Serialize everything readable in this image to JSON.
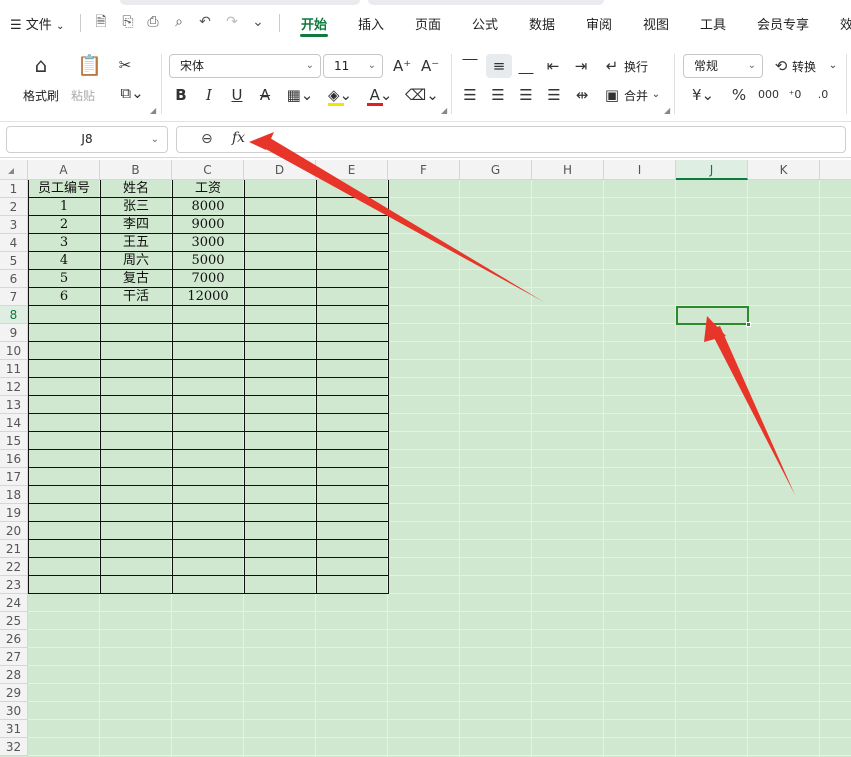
{
  "menu": {
    "file_label": "文件",
    "items": [
      "开始",
      "插入",
      "页面",
      "公式",
      "数据",
      "审阅",
      "视图",
      "工具",
      "会员专享",
      "效"
    ]
  },
  "ribbon": {
    "format_painter": "格式刷",
    "paste": "粘贴",
    "font_name": "宋体",
    "font_size": "11",
    "wrap": "换行",
    "merge": "合并",
    "number_format": "常规",
    "convert": "转换"
  },
  "formula_bar": {
    "name_box": "J8",
    "fx": "fx",
    "formula": ""
  },
  "sheet": {
    "columns": [
      "A",
      "B",
      "C",
      "D",
      "E",
      "F",
      "G",
      "H",
      "I",
      "J",
      "K"
    ],
    "selected_column": "J",
    "selected_row": "8",
    "rows": [
      "1",
      "2",
      "3",
      "4",
      "5",
      "6",
      "7",
      "8",
      "9",
      "10",
      "11",
      "12",
      "13",
      "14",
      "15",
      "16",
      "17",
      "18",
      "19",
      "20",
      "21",
      "22",
      "23",
      "24",
      "25",
      "26",
      "27",
      "28",
      "29",
      "30",
      "31",
      "32"
    ],
    "table": [
      [
        "员工编号",
        "姓名",
        "工资"
      ],
      [
        "1",
        "张三",
        "8000"
      ],
      [
        "2",
        "李四",
        "9000"
      ],
      [
        "3",
        "王五",
        "3000"
      ],
      [
        "4",
        "周六",
        "5000"
      ],
      [
        "5",
        "复古",
        "7000"
      ],
      [
        "6",
        "干活",
        "12000"
      ]
    ]
  },
  "colors": {
    "accent": "#0f7a3d",
    "sheet_background": "#cfe8cf",
    "arrow": "#e8352a",
    "selection": "#2f8a2f"
  }
}
